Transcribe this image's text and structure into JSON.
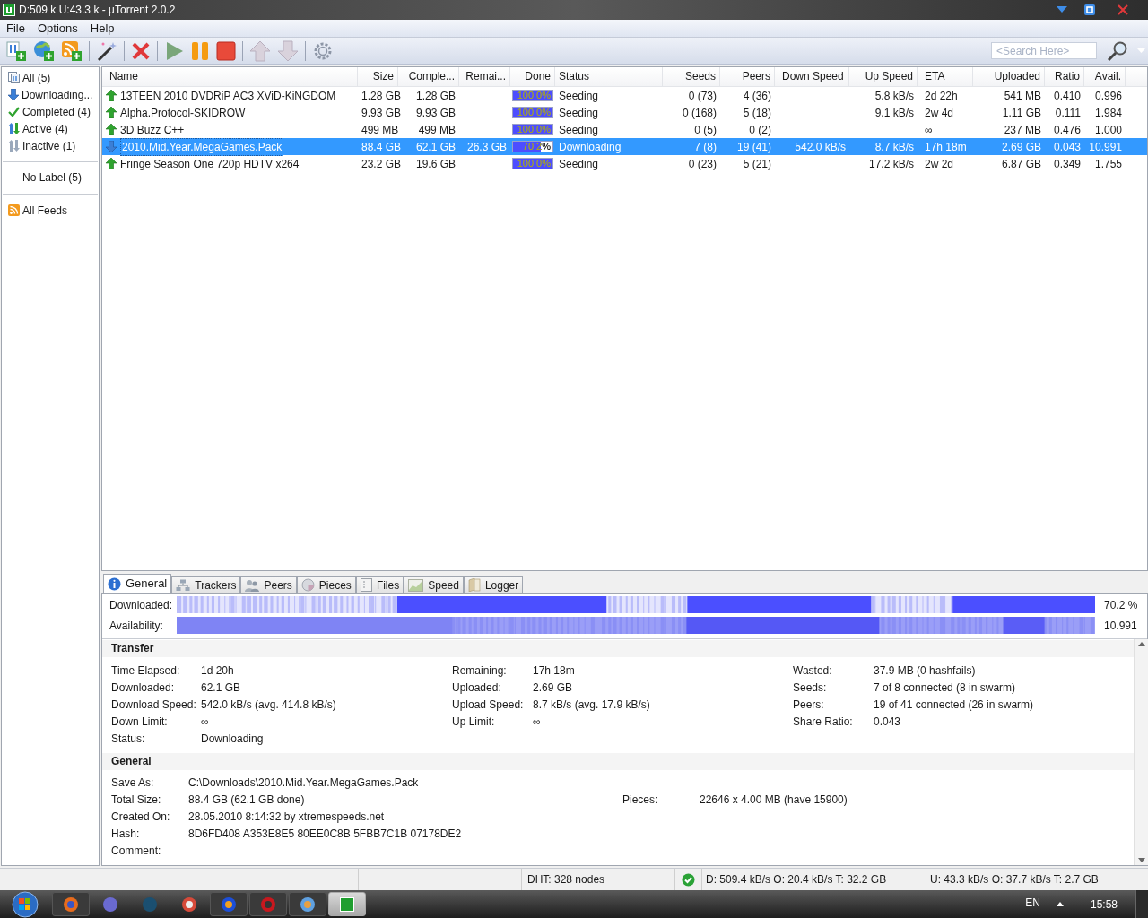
{
  "window": {
    "title": "D:509 k U:43.3 k - µTorrent 2.0.2"
  },
  "menu": [
    "File",
    "Options",
    "Help"
  ],
  "toolbar": {
    "search": {
      "placeholder": "<Search Here>"
    }
  },
  "sidebar": {
    "categories": [
      {
        "label": "All (5)",
        "kind": "all"
      },
      {
        "label": "Downloading...",
        "kind": "down"
      },
      {
        "label": "Completed (4)",
        "kind": "done"
      },
      {
        "label": "Active (4)",
        "kind": "active"
      },
      {
        "label": "Inactive (1)",
        "kind": "inactive"
      }
    ],
    "labels": [
      "No Label (5)"
    ],
    "feeds": [
      "All Feeds"
    ]
  },
  "table": {
    "columns": [
      "Name",
      "Size",
      "Comple...",
      "Remai...",
      "Done",
      "Status",
      "Seeds",
      "Peers",
      "Down Speed",
      "Up Speed",
      "ETA",
      "Uploaded",
      "Ratio",
      "Avail."
    ],
    "rows": [
      {
        "kind": "seed",
        "selected": false,
        "name": "13TEEN 2010 DVDRiP AC3 XViD-KiNGDOM",
        "size": "1.28 GB",
        "completed": "1.28 GB",
        "done": "100.0%",
        "level": 1,
        "status": "Seeding",
        "seeds": "0 (73)",
        "peers": "4 (36)",
        "up_speed": "5.8 kB/s",
        "eta": "2d 22h",
        "uploaded": "541 MB",
        "ratio": "0.410",
        "avail": "0.996"
      },
      {
        "kind": "seed",
        "selected": false,
        "name": "Alpha.Protocol-SKIDROW",
        "size": "9.93 GB",
        "completed": "9.93 GB",
        "done": "100.0%",
        "level": 1,
        "status": "Seeding",
        "seeds": "0 (168)",
        "peers": "5 (18)",
        "up_speed": "9.1 kB/s",
        "eta": "2w 4d",
        "uploaded": "1.11 GB",
        "ratio": "0.111",
        "avail": "1.984"
      },
      {
        "kind": "seed",
        "selected": false,
        "name": "3D Buzz C++",
        "size": "499 MB",
        "completed": "499 MB",
        "done": "100.0%",
        "level": 1,
        "status": "Seeding",
        "seeds": "0 (5)",
        "peers": "0 (2)",
        "eta": "∞",
        "uploaded": "237 MB",
        "ratio": "0.476",
        "avail": "1.000"
      },
      {
        "kind": "download",
        "selected": true,
        "name": "2010.Mid.Year.MegaGames.Pack",
        "size": "88.4 GB",
        "completed": "62.1 GB",
        "remaining": "26.3 GB",
        "done": "70.2%",
        "level": 0.702,
        "status": "Downloading",
        "seeds": "7 (8)",
        "peers": "19 (41)",
        "down_speed": "542.0 kB/s",
        "up_speed": "8.7 kB/s",
        "eta": "17h 18m",
        "uploaded": "2.69 GB",
        "ratio": "0.043",
        "avail": "10.991"
      },
      {
        "kind": "seed",
        "selected": false,
        "name": "Fringe Season One 720p HDTV x264",
        "size": "23.2 GB",
        "completed": "19.6 GB",
        "done": "100.0%",
        "level": 1,
        "status": "Seeding",
        "seeds": "0 (23)",
        "peers": "5 (21)",
        "up_speed": "17.2 kB/s",
        "eta": "2w 2d",
        "uploaded": "6.87 GB",
        "ratio": "0.349",
        "avail": "1.755"
      }
    ]
  },
  "details": {
    "tabs": [
      {
        "label": "General",
        "kind": "info",
        "selected": true
      },
      {
        "label": "Trackers",
        "kind": "trackers",
        "selected": false
      },
      {
        "label": "Peers",
        "kind": "peers",
        "selected": false
      },
      {
        "label": "Pieces",
        "kind": "pieces",
        "selected": false
      },
      {
        "label": "Files",
        "kind": "files",
        "selected": false
      },
      {
        "label": "Speed",
        "kind": "speed",
        "selected": false
      },
      {
        "label": "Logger",
        "kind": "logger",
        "selected": false
      }
    ],
    "downloaded": {
      "label": "Downloaded:",
      "reading": "70.2 %"
    },
    "availability": {
      "label": "Availability:",
      "reading": "10.991"
    },
    "transfer": {
      "title": "Transfer",
      "columns": [
        [
          {
            "label": "Time Elapsed:",
            "value": "1d 20h"
          },
          {
            "label": "Downloaded:",
            "value": "62.1 GB"
          },
          {
            "label": "Download Speed:",
            "value": "542.0 kB/s (avg. 414.8 kB/s)"
          },
          {
            "label": "Down Limit:",
            "value": "∞"
          },
          {
            "label": "Status:",
            "value": "Downloading"
          }
        ],
        [
          {
            "label": "Remaining:",
            "value": "17h 18m"
          },
          {
            "label": "Uploaded:",
            "value": "2.69 GB"
          },
          {
            "label": "Upload Speed:",
            "value": "8.7 kB/s (avg. 17.9 kB/s)"
          },
          {
            "label": "Up Limit:",
            "value": "∞"
          }
        ],
        [
          {
            "label": "Wasted:",
            "value": "37.9 MB (0 hashfails)"
          },
          {
            "label": "Seeds:",
            "value": "7 of 8 connected (8 in swarm)"
          },
          {
            "label": "Peers:",
            "value": "19 of 41 connected (26 in swarm)"
          },
          {
            "label": "Share Ratio:",
            "value": "0.043"
          }
        ]
      ]
    },
    "general": {
      "title": "General",
      "rows": [
        [
          {
            "label": "Save As:",
            "value": "C:\\Downloads\\2010.Mid.Year.MegaGames.Pack"
          }
        ],
        [
          {
            "label": "Total Size:",
            "value": "88.4 GB (62.1 GB done)"
          },
          {
            "label": "Pieces:",
            "value": "22646 x 4.00 MB (have 15900)"
          }
        ],
        [
          {
            "label": "Created On:",
            "value": "28.05.2010 8:14:32 by xtremespeeds.net"
          }
        ],
        [
          {
            "label": "Hash:",
            "value": "8D6FD408 A353E8E5 80EE0C8B 5FBB7C1B 07178DE2"
          }
        ],
        [
          {
            "label": "Comment:"
          }
        ]
      ]
    }
  },
  "status_bar": {
    "dht": "DHT: 328 nodes",
    "download": "D: 509.4 kB/s O: 20.4 kB/s T: 32.2 GB",
    "upload": "U: 43.3 kB/s O: 37.7 kB/s T: 2.7 GB"
  },
  "taskbar": {
    "language": "EN",
    "time": "15:58"
  }
}
